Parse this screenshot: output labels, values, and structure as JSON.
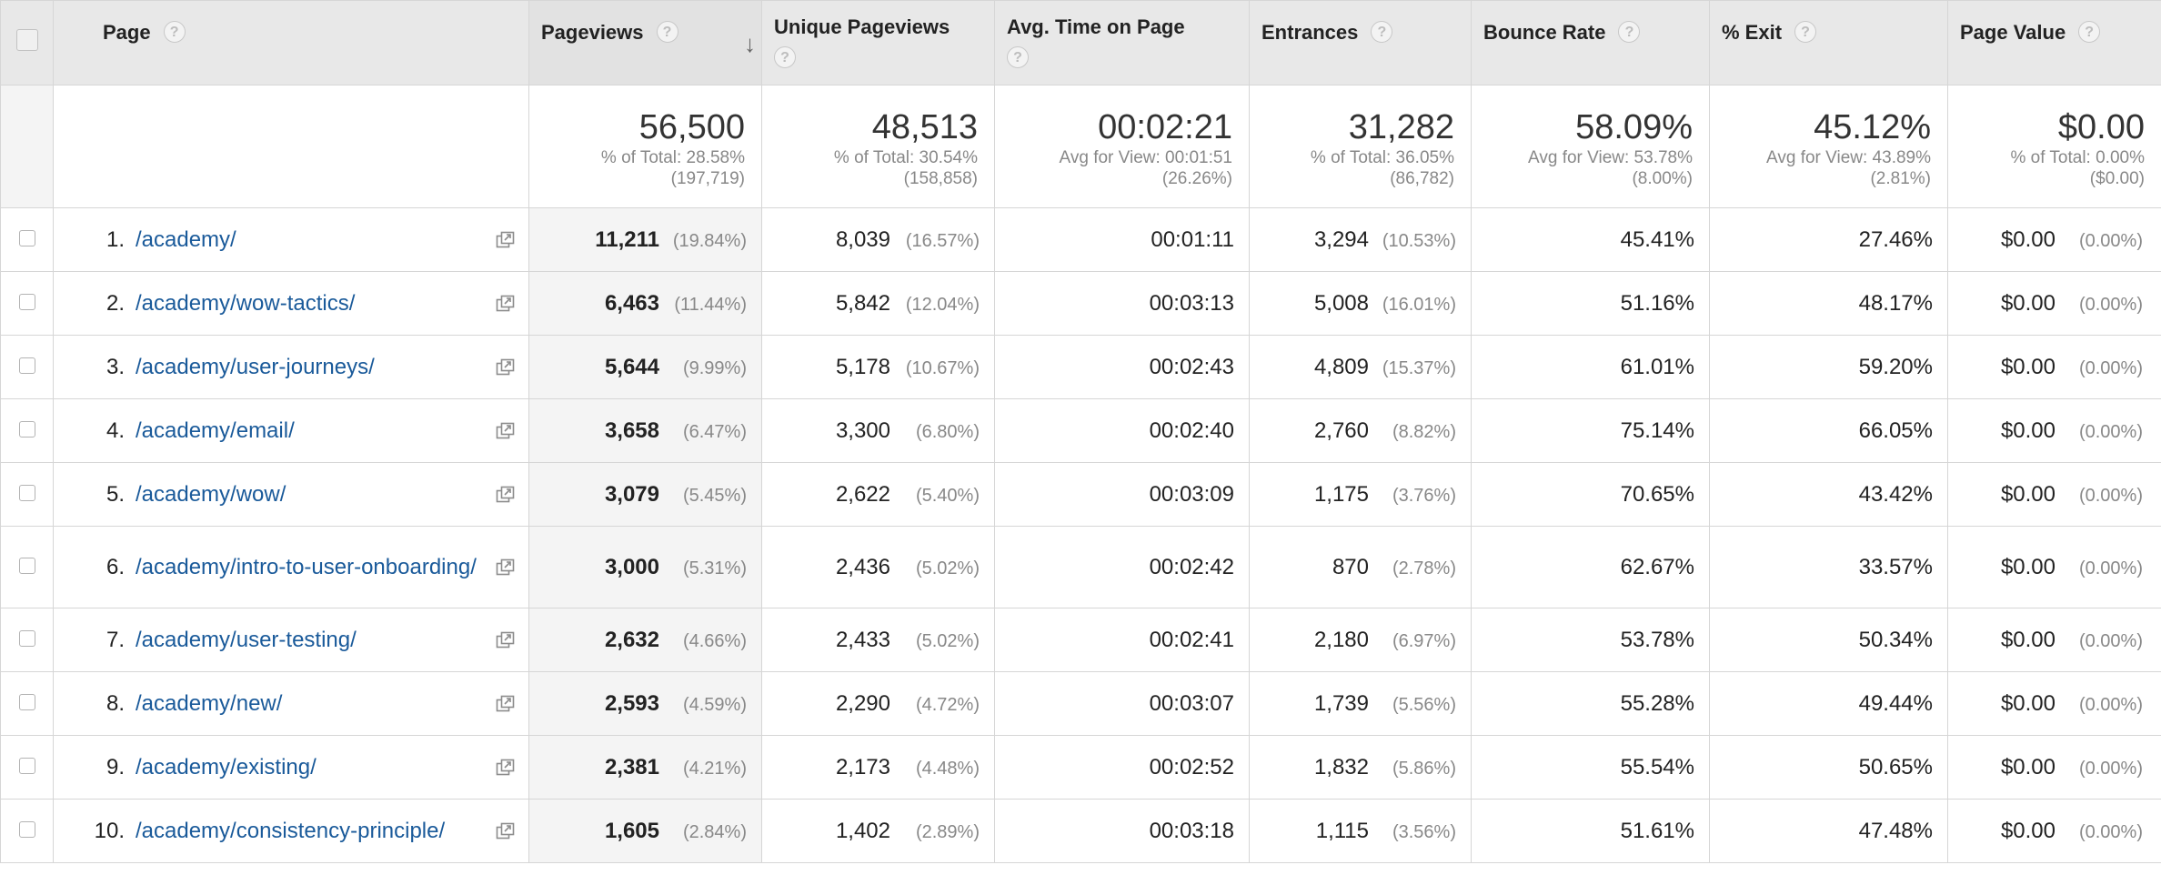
{
  "headers": {
    "page": "Page",
    "pageviews": "Pageviews",
    "unique_pageviews": "Unique Pageviews",
    "avg_time": "Avg. Time on Page",
    "entrances": "Entrances",
    "bounce_rate": "Bounce Rate",
    "exit": "% Exit",
    "page_value": "Page Value",
    "help_glyph": "?",
    "sort_glyph": "↓"
  },
  "totals": {
    "pageviews": {
      "value": "56,500",
      "line1": "% of Total: 28.58%",
      "line2": "(197,719)"
    },
    "unique_pageviews": {
      "value": "48,513",
      "line1": "% of Total: 30.54%",
      "line2": "(158,858)"
    },
    "avg_time": {
      "value": "00:02:21",
      "line1": "Avg for View: 00:01:51",
      "line2": "(26.26%)"
    },
    "entrances": {
      "value": "31,282",
      "line1": "% of Total: 36.05%",
      "line2": "(86,782)"
    },
    "bounce_rate": {
      "value": "58.09%",
      "line1": "Avg for View: 53.78%",
      "line2": "(8.00%)"
    },
    "exit": {
      "value": "45.12%",
      "line1": "Avg for View: 43.89%",
      "line2": "(2.81%)"
    },
    "page_value": {
      "value": "$0.00",
      "line1": "% of Total: 0.00%",
      "line2": "($0.00)"
    }
  },
  "rows": [
    {
      "rank": "1.",
      "page": "/academy/",
      "pv": "11,211",
      "pv_pct": "(19.84%)",
      "upv": "8,039",
      "upv_pct": "(16.57%)",
      "time": "00:01:11",
      "ent": "3,294",
      "ent_pct": "(10.53%)",
      "bounce": "45.41%",
      "exit": "27.46%",
      "value": "$0.00",
      "value_pct": "(0.00%)"
    },
    {
      "rank": "2.",
      "page": "/academy/wow-tactics/",
      "pv": "6,463",
      "pv_pct": "(11.44%)",
      "upv": "5,842",
      "upv_pct": "(12.04%)",
      "time": "00:03:13",
      "ent": "5,008",
      "ent_pct": "(16.01%)",
      "bounce": "51.16%",
      "exit": "48.17%",
      "value": "$0.00",
      "value_pct": "(0.00%)"
    },
    {
      "rank": "3.",
      "page": "/academy/user-journeys/",
      "pv": "5,644",
      "pv_pct": "(9.99%)",
      "upv": "5,178",
      "upv_pct": "(10.67%)",
      "time": "00:02:43",
      "ent": "4,809",
      "ent_pct": "(15.37%)",
      "bounce": "61.01%",
      "exit": "59.20%",
      "value": "$0.00",
      "value_pct": "(0.00%)"
    },
    {
      "rank": "4.",
      "page": "/academy/email/",
      "pv": "3,658",
      "pv_pct": "(6.47%)",
      "upv": "3,300",
      "upv_pct": "(6.80%)",
      "time": "00:02:40",
      "ent": "2,760",
      "ent_pct": "(8.82%)",
      "bounce": "75.14%",
      "exit": "66.05%",
      "value": "$0.00",
      "value_pct": "(0.00%)"
    },
    {
      "rank": "5.",
      "page": "/academy/wow/",
      "pv": "3,079",
      "pv_pct": "(5.45%)",
      "upv": "2,622",
      "upv_pct": "(5.40%)",
      "time": "00:03:09",
      "ent": "1,175",
      "ent_pct": "(3.76%)",
      "bounce": "70.65%",
      "exit": "43.42%",
      "value": "$0.00",
      "value_pct": "(0.00%)"
    },
    {
      "rank": "6.",
      "page": "/academy/intro-to-user-onboarding/",
      "pv": "3,000",
      "pv_pct": "(5.31%)",
      "upv": "2,436",
      "upv_pct": "(5.02%)",
      "time": "00:02:42",
      "ent": "870",
      "ent_pct": "(2.78%)",
      "bounce": "62.67%",
      "exit": "33.57%",
      "value": "$0.00",
      "value_pct": "(0.00%)"
    },
    {
      "rank": "7.",
      "page": "/academy/user-testing/",
      "pv": "2,632",
      "pv_pct": "(4.66%)",
      "upv": "2,433",
      "upv_pct": "(5.02%)",
      "time": "00:02:41",
      "ent": "2,180",
      "ent_pct": "(6.97%)",
      "bounce": "53.78%",
      "exit": "50.34%",
      "value": "$0.00",
      "value_pct": "(0.00%)"
    },
    {
      "rank": "8.",
      "page": "/academy/new/",
      "pv": "2,593",
      "pv_pct": "(4.59%)",
      "upv": "2,290",
      "upv_pct": "(4.72%)",
      "time": "00:03:07",
      "ent": "1,739",
      "ent_pct": "(5.56%)",
      "bounce": "55.28%",
      "exit": "49.44%",
      "value": "$0.00",
      "value_pct": "(0.00%)"
    },
    {
      "rank": "9.",
      "page": "/academy/existing/",
      "pv": "2,381",
      "pv_pct": "(4.21%)",
      "upv": "2,173",
      "upv_pct": "(4.48%)",
      "time": "00:02:52",
      "ent": "1,832",
      "ent_pct": "(5.86%)",
      "bounce": "55.54%",
      "exit": "50.65%",
      "value": "$0.00",
      "value_pct": "(0.00%)"
    },
    {
      "rank": "10.",
      "page": "/academy/consistency-principle/",
      "pv": "1,605",
      "pv_pct": "(2.84%)",
      "upv": "1,402",
      "upv_pct": "(2.89%)",
      "time": "00:03:18",
      "ent": "1,115",
      "ent_pct": "(3.56%)",
      "bounce": "51.61%",
      "exit": "47.48%",
      "value": "$0.00",
      "value_pct": "(0.00%)"
    }
  ],
  "icons": {
    "checkbox": "checkbox-icon",
    "help": "help-icon",
    "sort": "sort-down-icon",
    "open_page": "open-in-new-window-icon"
  },
  "colors": {
    "link": "#1a5a9a",
    "header_bg": "#e8e8e8",
    "muted": "#888888"
  }
}
